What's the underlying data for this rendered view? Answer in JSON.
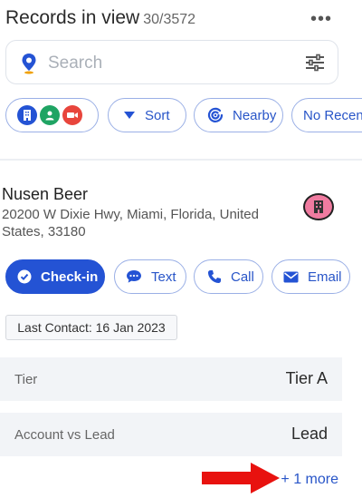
{
  "header": {
    "title": "Records in view",
    "count": "30/3572",
    "menu_icon": "more-dots-icon"
  },
  "search": {
    "placeholder": "Search"
  },
  "chips": {
    "sort_label": "Sort",
    "nearby_label": "Nearby",
    "no_recent_label": "No Recen"
  },
  "record": {
    "name": "Nusen Beer",
    "address": "20200 W Dixie Hwy, Miami, Florida, United States, 33180"
  },
  "actions": {
    "checkin_label": "Check-in",
    "text_label": "Text",
    "call_label": "Call",
    "email_label": "Email"
  },
  "last_contact": "Last Contact: 16 Jan 2023",
  "fields": [
    {
      "label": "Tier",
      "value": "Tier A"
    },
    {
      "label": "Account vs Lead",
      "value": "Lead"
    }
  ],
  "more_link": "+ 1 more",
  "colors": {
    "accent": "#2453d4",
    "annotation_arrow": "#e8120f",
    "badge": "#f07ba0"
  }
}
